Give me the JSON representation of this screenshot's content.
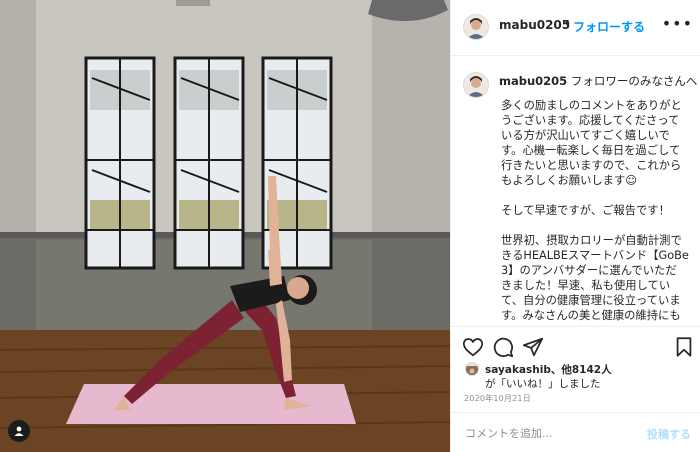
{
  "post": {
    "username": "mabu0205",
    "separator": "•",
    "follow_label": "フォローする",
    "more_icon": "more-horizontal-icon"
  },
  "caption": {
    "username": "mabu0205",
    "first_line": "フォロワーのみなさんへ",
    "paragraphs": [
      "多くの励ましのコメントをありがと\nうございます。応援してくださって\nいる方が沢山いてすごく嬉しいで\nす。心機一転楽しく毎日を過ごして\n行きたいと思いますので、これから\nもよろしくお願いします☺",
      "そして早速ですが、ご報告です！",
      "世界初、摂取カロリーが自動計測で\nきるHEALBEスマートバンド【GoBe\n3】のアンバサダーに選んでいただ\nきました！早速、私も使用してい\nて、自分の健康管理に役立っていま\nす。みなさんの美と健康の維持にも\n役立てるよう、しっかりと魅力を伝\nえて行きたいと思います。"
    ]
  },
  "actions": {
    "like_icon": "heart-outline-icon",
    "comment_icon": "comment-icon",
    "share_icon": "paper-plane-icon",
    "save_icon": "bookmark-icon"
  },
  "likes": {
    "liker": "sayakashib",
    "others": "、他8142人",
    "suffix": "が「いいね！」しました"
  },
  "date": "2020年10月21日",
  "comment_box": {
    "placeholder": "コメントを追加...",
    "post_label": "投稿する"
  },
  "colors": {
    "link_blue": "#0095f6",
    "post_disabled": "#b2dffc",
    "mat_pink": "#e7b9cf",
    "leggings": "#7d2233"
  }
}
